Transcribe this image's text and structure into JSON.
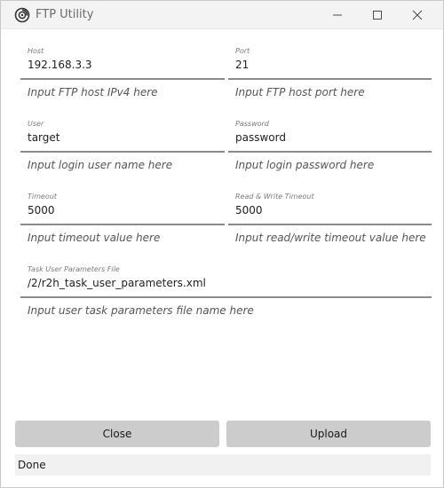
{
  "window": {
    "title": "FTP Utility",
    "icon": "swirl-app-icon",
    "controls": {
      "minimize": "minimize-icon",
      "maximize": "maximize-icon",
      "close": "close-icon"
    }
  },
  "form": {
    "host": {
      "label": "Host",
      "value": "192.168.3.3",
      "hint": "Input FTP host IPv4 here"
    },
    "port": {
      "label": "Port",
      "value": "21",
      "hint": "Input FTP host port here"
    },
    "user": {
      "label": "User",
      "value": "target",
      "hint": "Input login user name here"
    },
    "password": {
      "label": "Password",
      "value": "password",
      "hint": "Input login password here"
    },
    "timeout": {
      "label": "Timeout",
      "value": "5000",
      "hint": "Input timeout value here"
    },
    "rw_timeout": {
      "label": "Read & Write Timeout",
      "value": "5000",
      "hint": "Input read/write timeout value here"
    },
    "task_file": {
      "label": "Task User Parameters File",
      "value": "/2/r2h_task_user_parameters.xml",
      "hint": "Input user task parameters file name here"
    }
  },
  "actions": {
    "close_label": "Close",
    "upload_label": "Upload"
  },
  "status": {
    "text": "Done"
  },
  "colors": {
    "titlebar_bg": "#f3f3f3",
    "button_bg": "#cccccc",
    "underline": "#8a8a8a",
    "status_bg": "#f1f1f1"
  }
}
